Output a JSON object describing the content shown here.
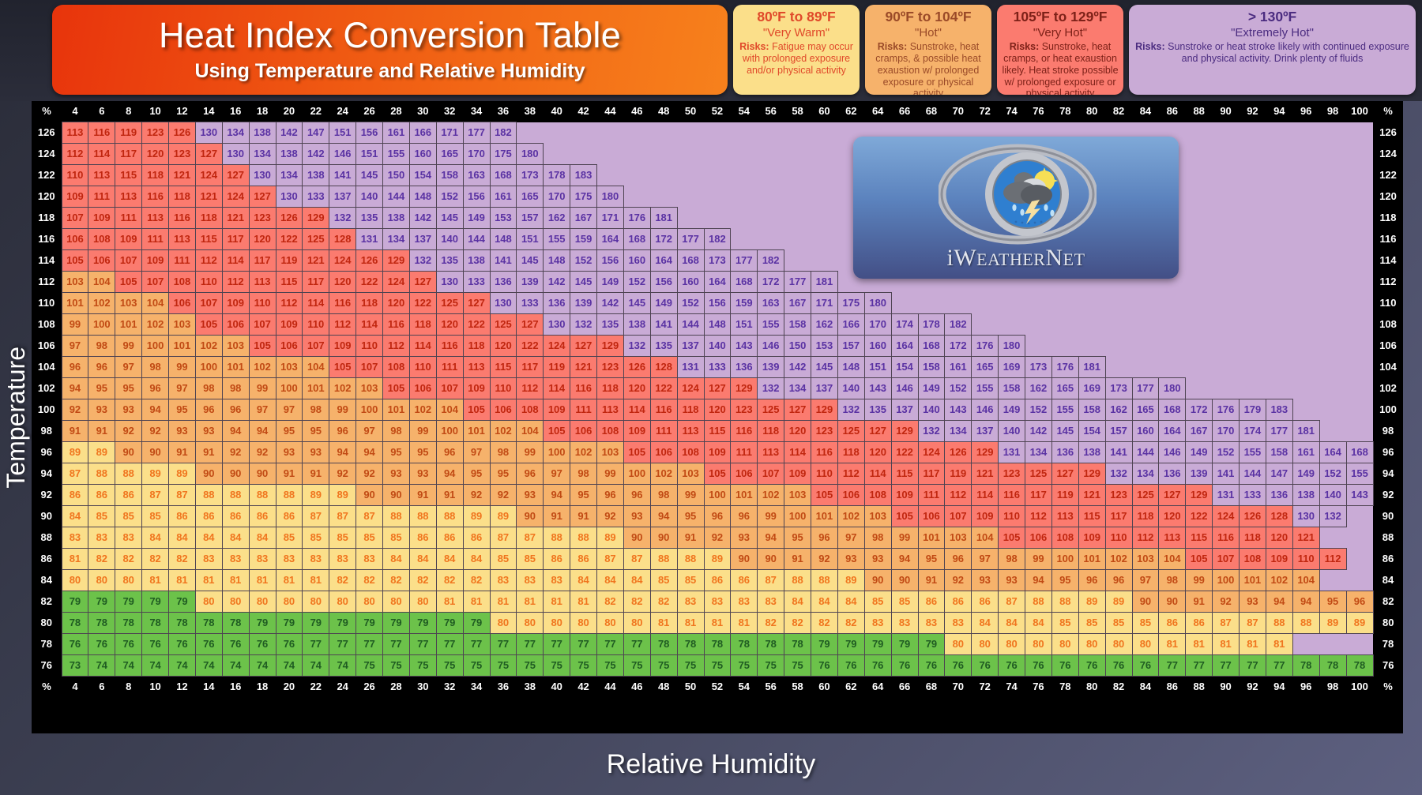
{
  "title": {
    "main": "Heat Index Conversion Table",
    "sub": "Using Temperature and Relative Humidity"
  },
  "legend": [
    {
      "range": "80ºF to 89ºF",
      "name": "\"Very Warm\"",
      "risk_label": "Risks:",
      "risk_text": " Fatigue may occur with prolonged exposure and/or physical activity",
      "color": "#fbdf8a"
    },
    {
      "range": "90ºF to 104ºF",
      "name": "\"Hot\"",
      "risk_label": "Risks:",
      "risk_text": " Sunstroke, heat cramps, & possible heat exaustion w/ prolonged exposure or physical activity",
      "color": "#f6b26b"
    },
    {
      "range": "105ºF to 129ºF",
      "name": "\"Very Hot\"",
      "risk_label": "Risks:",
      "risk_text": " Sunstroke, heat cramps, or heat exaustion likely. Heat stroke possible w/ prolonged exposure or physical activity",
      "color": "#fb7b6f"
    },
    {
      "range": "> 130ºF",
      "name": "\"Extremely Hot\"",
      "risk_label": "Risks:",
      "risk_text": " Sunstroke or heat stroke likely with continued exposure and physical activity. Drink plenty of fluids",
      "color": "#c9abd6"
    }
  ],
  "axis": {
    "x_title": "Relative Humidity",
    "y_title": "Temperature",
    "corner_symbol": "%"
  },
  "logo": {
    "text_i": "i",
    "text_w": "W",
    "text_eather": "EATHER",
    "text_n": "N",
    "text_et": "ET",
    "full": "iWeatherNet"
  },
  "bands": {
    "green": "#6cc24a",
    "yellow": "#fbdf8a",
    "orange": "#f6b26b",
    "red": "#fb7b6f",
    "purple": "#c9abd6"
  },
  "chart_data": {
    "type": "heatmap",
    "title": "Heat Index Conversion Table",
    "subtitle": "Using Temperature and Relative Humidity",
    "xlabel": "Relative Humidity",
    "ylabel": "Temperature",
    "x": [
      4,
      6,
      8,
      10,
      12,
      14,
      16,
      18,
      20,
      22,
      24,
      26,
      28,
      30,
      32,
      34,
      36,
      38,
      40,
      42,
      44,
      46,
      48,
      50,
      52,
      54,
      56,
      58,
      60,
      62,
      64,
      66,
      68,
      70,
      72,
      74,
      76,
      78,
      80,
      82,
      84,
      86,
      88,
      90,
      92,
      94,
      96,
      98,
      100
    ],
    "y": [
      126,
      124,
      122,
      120,
      118,
      116,
      114,
      112,
      110,
      108,
      106,
      104,
      102,
      100,
      98,
      96,
      94,
      92,
      90,
      88,
      86,
      84,
      82,
      80,
      78,
      76
    ],
    "legend_position": "top-right",
    "grid": true,
    "values": [
      [
        113,
        116,
        119,
        123,
        126,
        130,
        134,
        138,
        142,
        147,
        151,
        156,
        161,
        166,
        171,
        177,
        182,
        null,
        null,
        null,
        null,
        null,
        null,
        null,
        null,
        null,
        null,
        null,
        null,
        null,
        null,
        null,
        null,
        null,
        null,
        null,
        null,
        null,
        null,
        null,
        null,
        null,
        null,
        null,
        null,
        null,
        null,
        null,
        null
      ],
      [
        112,
        114,
        117,
        120,
        123,
        127,
        130,
        134,
        138,
        142,
        146,
        151,
        155,
        160,
        165,
        170,
        175,
        180,
        null,
        null,
        null,
        null,
        null,
        null,
        null,
        null,
        null,
        null,
        null,
        null,
        null,
        null,
        null,
        null,
        null,
        null,
        null,
        null,
        null,
        null,
        null,
        null,
        null,
        null,
        null,
        null,
        null,
        null,
        null
      ],
      [
        110,
        113,
        115,
        118,
        121,
        124,
        127,
        130,
        134,
        138,
        141,
        145,
        150,
        154,
        158,
        163,
        168,
        173,
        178,
        183,
        null,
        null,
        null,
        null,
        null,
        null,
        null,
        null,
        null,
        null,
        null,
        null,
        null,
        null,
        null,
        null,
        null,
        null,
        null,
        null,
        null,
        null,
        null,
        null,
        null,
        null,
        null,
        null,
        null
      ],
      [
        109,
        111,
        113,
        116,
        118,
        121,
        124,
        127,
        130,
        133,
        137,
        140,
        144,
        148,
        152,
        156,
        161,
        165,
        170,
        175,
        180,
        null,
        null,
        null,
        null,
        null,
        null,
        null,
        null,
        null,
        null,
        null,
        null,
        null,
        null,
        null,
        null,
        null,
        null,
        null,
        null,
        null,
        null,
        null,
        null,
        null,
        null,
        null,
        null
      ],
      [
        107,
        109,
        111,
        113,
        116,
        118,
        121,
        123,
        126,
        129,
        132,
        135,
        138,
        142,
        145,
        149,
        153,
        157,
        162,
        167,
        171,
        176,
        181,
        null,
        null,
        null,
        null,
        null,
        null,
        null,
        null,
        null,
        null,
        null,
        null,
        null,
        null,
        null,
        null,
        null,
        null,
        null,
        null,
        null,
        null,
        null,
        null,
        null,
        null
      ],
      [
        106,
        108,
        109,
        111,
        113,
        115,
        117,
        120,
        122,
        125,
        128,
        131,
        134,
        137,
        140,
        144,
        148,
        151,
        155,
        159,
        164,
        168,
        172,
        177,
        182,
        null,
        null,
        null,
        null,
        null,
        null,
        null,
        null,
        null,
        null,
        null,
        null,
        null,
        null,
        null,
        null,
        null,
        null,
        null,
        null,
        null,
        null,
        null,
        null
      ],
      [
        105,
        106,
        107,
        109,
        111,
        112,
        114,
        117,
        119,
        121,
        124,
        126,
        129,
        132,
        135,
        138,
        141,
        145,
        148,
        152,
        156,
        160,
        164,
        168,
        173,
        177,
        182,
        null,
        null,
        null,
        null,
        null,
        null,
        null,
        null,
        null,
        null,
        null,
        null,
        null,
        null,
        null,
        null,
        null,
        null,
        null,
        null,
        null,
        null
      ],
      [
        103,
        104,
        105,
        107,
        108,
        110,
        112,
        113,
        115,
        117,
        120,
        122,
        124,
        127,
        130,
        133,
        136,
        139,
        142,
        145,
        149,
        152,
        156,
        160,
        164,
        168,
        172,
        177,
        181,
        null,
        null,
        null,
        null,
        null,
        null,
        null,
        null,
        null,
        null,
        null,
        null,
        null,
        null,
        null,
        null,
        null,
        null,
        null,
        null
      ],
      [
        101,
        102,
        103,
        104,
        106,
        107,
        109,
        110,
        112,
        114,
        116,
        118,
        120,
        122,
        125,
        127,
        130,
        133,
        136,
        139,
        142,
        145,
        149,
        152,
        156,
        159,
        163,
        167,
        171,
        175,
        180,
        null,
        null,
        null,
        null,
        null,
        null,
        null,
        null,
        null,
        null,
        null,
        null,
        null,
        null,
        null,
        null,
        null,
        null
      ],
      [
        99,
        100,
        101,
        102,
        103,
        105,
        106,
        107,
        109,
        110,
        112,
        114,
        116,
        118,
        120,
        122,
        125,
        127,
        130,
        132,
        135,
        138,
        141,
        144,
        148,
        151,
        155,
        158,
        162,
        166,
        170,
        174,
        178,
        182,
        null,
        null,
        null,
        null,
        null,
        null,
        null,
        null,
        null,
        null,
        null,
        null,
        null,
        null,
        null
      ],
      [
        97,
        98,
        99,
        100,
        101,
        102,
        103,
        105,
        106,
        107,
        109,
        110,
        112,
        114,
        116,
        118,
        120,
        122,
        124,
        127,
        129,
        132,
        135,
        137,
        140,
        143,
        146,
        150,
        153,
        157,
        160,
        164,
        168,
        172,
        176,
        180,
        null,
        null,
        null,
        null,
        null,
        null,
        null,
        null,
        null,
        null,
        null,
        null,
        null
      ],
      [
        96,
        96,
        97,
        98,
        99,
        100,
        101,
        102,
        103,
        104,
        105,
        107,
        108,
        110,
        111,
        113,
        115,
        117,
        119,
        121,
        123,
        126,
        128,
        131,
        133,
        136,
        139,
        142,
        145,
        148,
        151,
        154,
        158,
        161,
        165,
        169,
        173,
        176,
        181,
        null,
        null,
        null,
        null,
        null,
        null,
        null,
        null,
        null,
        null
      ],
      [
        94,
        95,
        95,
        96,
        97,
        98,
        98,
        99,
        100,
        101,
        102,
        103,
        105,
        106,
        107,
        109,
        110,
        112,
        114,
        116,
        118,
        120,
        122,
        124,
        127,
        129,
        132,
        134,
        137,
        140,
        143,
        146,
        149,
        152,
        155,
        158,
        162,
        165,
        169,
        173,
        177,
        180,
        null,
        null,
        null,
        null,
        null,
        null,
        null
      ],
      [
        92,
        93,
        93,
        94,
        95,
        96,
        96,
        97,
        97,
        98,
        99,
        100,
        101,
        102,
        104,
        105,
        106,
        108,
        109,
        111,
        113,
        114,
        116,
        118,
        120,
        123,
        125,
        127,
        129,
        132,
        135,
        137,
        140,
        143,
        146,
        149,
        152,
        155,
        158,
        162,
        165,
        168,
        172,
        176,
        179,
        183,
        null,
        null,
        null
      ],
      [
        91,
        91,
        92,
        92,
        93,
        93,
        94,
        94,
        95,
        95,
        96,
        97,
        98,
        99,
        100,
        101,
        102,
        104,
        105,
        106,
        108,
        109,
        111,
        113,
        115,
        116,
        118,
        120,
        123,
        125,
        127,
        129,
        132,
        134,
        137,
        140,
        142,
        145,
        154,
        157,
        160,
        164,
        167,
        170,
        174,
        177,
        181,
        null,
        null
      ],
      [
        89,
        89,
        90,
        90,
        91,
        91,
        92,
        92,
        93,
        93,
        94,
        94,
        95,
        95,
        96,
        97,
        98,
        99,
        100,
        102,
        103,
        105,
        106,
        108,
        109,
        111,
        113,
        114,
        116,
        118,
        120,
        122,
        124,
        126,
        129,
        131,
        134,
        136,
        138,
        141,
        144,
        146,
        149,
        152,
        155,
        158,
        161,
        164,
        168
      ],
      [
        87,
        88,
        88,
        89,
        89,
        90,
        90,
        90,
        91,
        91,
        92,
        92,
        93,
        93,
        94,
        95,
        95,
        96,
        97,
        98,
        99,
        100,
        102,
        103,
        105,
        106,
        107,
        109,
        110,
        112,
        114,
        115,
        117,
        119,
        121,
        123,
        125,
        127,
        129,
        132,
        134,
        136,
        139,
        141,
        144,
        147,
        149,
        152,
        155
      ],
      [
        86,
        86,
        86,
        87,
        87,
        88,
        88,
        88,
        88,
        89,
        89,
        90,
        90,
        91,
        91,
        92,
        92,
        93,
        94,
        95,
        96,
        96,
        98,
        99,
        100,
        101,
        102,
        103,
        105,
        106,
        108,
        109,
        111,
        112,
        114,
        116,
        117,
        119,
        121,
        123,
        125,
        127,
        129,
        131,
        133,
        136,
        138,
        140,
        143
      ],
      [
        84,
        85,
        85,
        85,
        86,
        86,
        86,
        86,
        86,
        87,
        87,
        87,
        88,
        88,
        88,
        89,
        89,
        90,
        91,
        91,
        92,
        93,
        94,
        95,
        96,
        96,
        99,
        100,
        101,
        102,
        103,
        105,
        106,
        107,
        109,
        110,
        112,
        113,
        115,
        117,
        118,
        120,
        122,
        124,
        126,
        128,
        130,
        132,
        null
      ],
      [
        83,
        83,
        83,
        84,
        84,
        84,
        84,
        84,
        85,
        85,
        85,
        85,
        85,
        86,
        86,
        86,
        87,
        87,
        88,
        88,
        89,
        90,
        90,
        91,
        92,
        93,
        94,
        95,
        96,
        97,
        98,
        99,
        101,
        103,
        104,
        105,
        106,
        108,
        109,
        110,
        112,
        113,
        115,
        116,
        118,
        120,
        121,
        null,
        null
      ],
      [
        81,
        82,
        82,
        82,
        82,
        83,
        83,
        83,
        83,
        83,
        83,
        83,
        84,
        84,
        84,
        84,
        85,
        85,
        86,
        86,
        87,
        87,
        88,
        88,
        89,
        90,
        90,
        91,
        92,
        93,
        93,
        94,
        95,
        96,
        97,
        98,
        99,
        100,
        101,
        102,
        103,
        104,
        105,
        107,
        108,
        109,
        110,
        112,
        null
      ],
      [
        80,
        80,
        80,
        81,
        81,
        81,
        81,
        81,
        81,
        81,
        82,
        82,
        82,
        82,
        82,
        82,
        83,
        83,
        83,
        84,
        84,
        84,
        85,
        85,
        86,
        86,
        87,
        88,
        88,
        89,
        90,
        90,
        91,
        92,
        93,
        93,
        94,
        95,
        96,
        96,
        97,
        98,
        99,
        100,
        101,
        102,
        104,
        null,
        null
      ],
      [
        79,
        79,
        79,
        79,
        79,
        80,
        80,
        80,
        80,
        80,
        80,
        80,
        80,
        80,
        81,
        81,
        81,
        81,
        81,
        81,
        82,
        82,
        82,
        83,
        83,
        83,
        83,
        84,
        84,
        84,
        85,
        85,
        86,
        86,
        86,
        87,
        88,
        88,
        89,
        89,
        90,
        90,
        91,
        92,
        93,
        94,
        94,
        95,
        96
      ],
      [
        78,
        78,
        78,
        78,
        78,
        78,
        78,
        79,
        79,
        79,
        79,
        79,
        79,
        79,
        79,
        79,
        80,
        80,
        80,
        80,
        80,
        80,
        81,
        81,
        81,
        81,
        82,
        82,
        82,
        82,
        83,
        83,
        83,
        83,
        84,
        84,
        84,
        85,
        85,
        85,
        85,
        86,
        86,
        87,
        87,
        88,
        88,
        89,
        89
      ],
      [
        76,
        76,
        76,
        76,
        76,
        76,
        76,
        76,
        76,
        77,
        77,
        77,
        77,
        77,
        77,
        77,
        77,
        77,
        77,
        77,
        77,
        77,
        78,
        78,
        78,
        78,
        78,
        78,
        79,
        79,
        79,
        79,
        79,
        80,
        80,
        80,
        80,
        80,
        80,
        80,
        80,
        81,
        81,
        81,
        81,
        81,
        null,
        null,
        null
      ],
      [
        73,
        74,
        74,
        74,
        74,
        74,
        74,
        74,
        74,
        74,
        74,
        75,
        75,
        75,
        75,
        75,
        75,
        75,
        75,
        75,
        75,
        75,
        75,
        75,
        75,
        75,
        75,
        75,
        76,
        76,
        76,
        76,
        76,
        76,
        76,
        76,
        76,
        76,
        76,
        76,
        76,
        77,
        77,
        77,
        77,
        77,
        78,
        78,
        78
      ]
    ]
  }
}
